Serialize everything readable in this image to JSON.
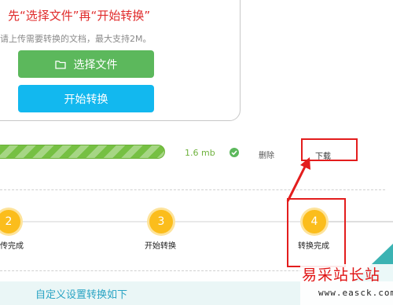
{
  "upload": {
    "instruction": "先“选择文件”再“开始转换”",
    "hint": "请上传需要转换的文档，最大支持2M。",
    "select_button": "选择文件",
    "start_button": "开始转换",
    "select_icon": "folder-icon"
  },
  "file": {
    "progress_percent": 100,
    "size": "1.6 mb",
    "status_icon": "check-circle-icon",
    "delete_label": "删除",
    "download_label": "下载"
  },
  "steps": {
    "items": [
      {
        "number": "2",
        "label": "传完成"
      },
      {
        "number": "3",
        "label": "开始转换"
      },
      {
        "number": "4",
        "label": "转换完成"
      }
    ]
  },
  "settings": {
    "title": "自定义设置转换如下"
  },
  "watermark": {
    "name": "易采站长站",
    "url": "www.easck.com"
  },
  "colors": {
    "instruction_red": "#e02b2b",
    "select_green": "#5cb85c",
    "start_blue": "#12b8ef",
    "progress_green": "#76c043",
    "step_yellow": "#fbbd1c",
    "highlight_red": "#e31d1d",
    "settings_teal": "#2aa4c4"
  }
}
